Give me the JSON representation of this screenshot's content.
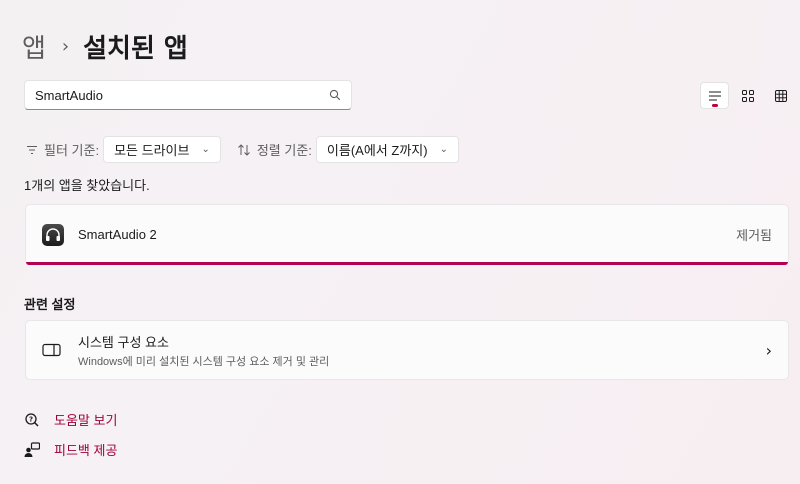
{
  "breadcrumb": {
    "parent": "앱",
    "separator": "›",
    "current": "설치된 앱"
  },
  "search": {
    "value": "SmartAudio"
  },
  "view_modes": [
    "list-view",
    "grid-view",
    "tile-view"
  ],
  "filter": {
    "label": "필터 기준:",
    "value": "모든 드라이브",
    "icon": "filter-icon"
  },
  "sort": {
    "label": "정렬 기준:",
    "value": "이름(A에서 Z까지)",
    "icon": "sort-icon"
  },
  "result_count": "1개의 앱을 찾았습니다.",
  "apps": [
    {
      "name": "SmartAudio 2",
      "status": "제거됨",
      "icon": "headphones-icon"
    }
  ],
  "related_settings": {
    "title": "관련 설정",
    "items": [
      {
        "title": "시스템 구성 요소",
        "description": "Windows에 미리 설치된 시스템 구성 요소 제거 및 관리",
        "icon": "component-icon"
      }
    ]
  },
  "links": [
    {
      "label": "도움말 보기",
      "icon": "help-icon"
    },
    {
      "label": "피드백 제공",
      "icon": "feedback-icon"
    }
  ],
  "colors": {
    "accent": "#b3004f",
    "link": "#a0003a"
  }
}
